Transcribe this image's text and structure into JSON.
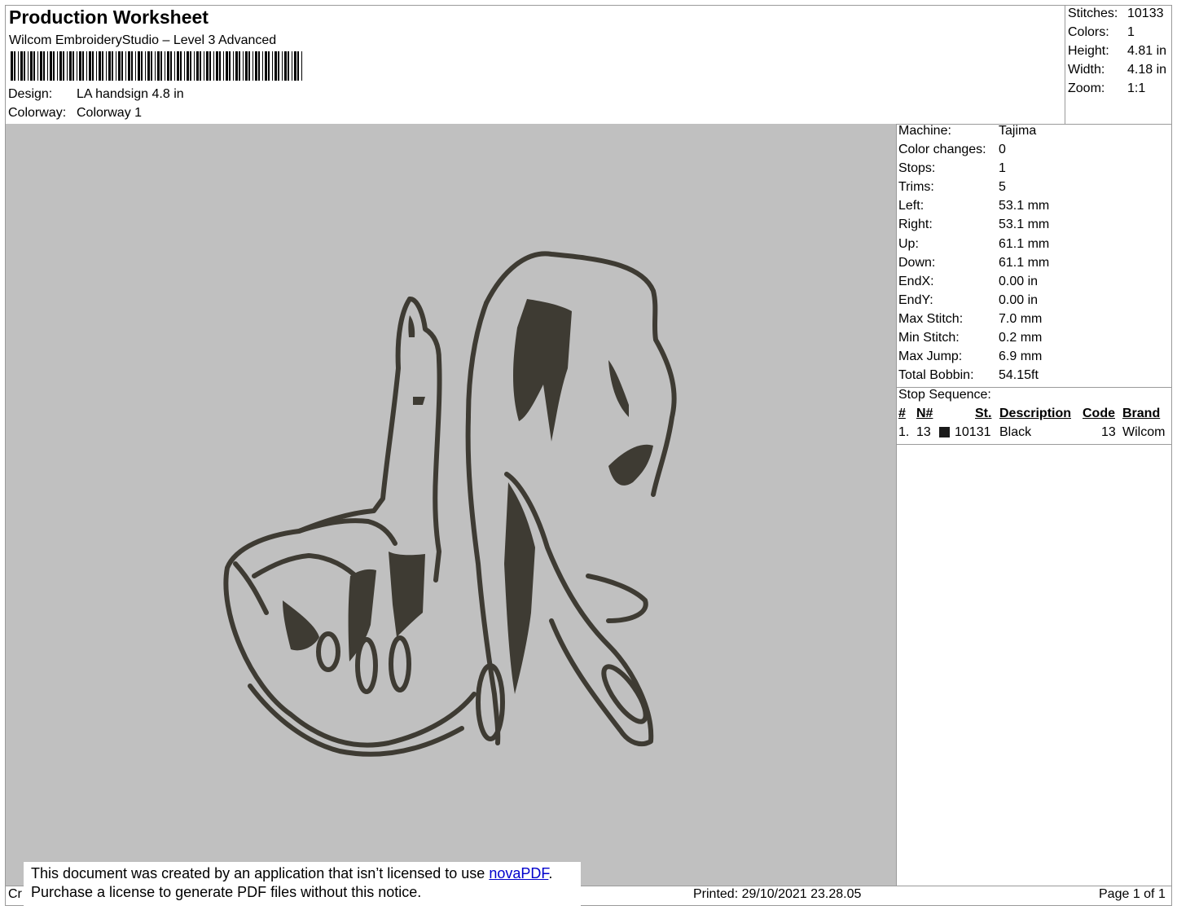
{
  "header": {
    "title": "Production Worksheet",
    "subtitle": "Wilcom EmbroideryStudio – Level 3 Advanced",
    "design_label": "Design:",
    "design_value": "LA handsign 4.8 in",
    "colorway_label": "Colorway:",
    "colorway_value": "Colorway 1"
  },
  "stats": [
    {
      "label": "Stitches:",
      "value": "10133"
    },
    {
      "label": "Colors:",
      "value": "1"
    },
    {
      "label": "Height:",
      "value": "4.81 in"
    },
    {
      "label": "Width:",
      "value": "4.18 in"
    },
    {
      "label": "Zoom:",
      "value": "1:1"
    }
  ],
  "specs": [
    {
      "label": "Machine:",
      "value": "Tajima"
    },
    {
      "label": "Color changes:",
      "value": "0"
    },
    {
      "label": "Stops:",
      "value": "1"
    },
    {
      "label": "Trims:",
      "value": "5"
    },
    {
      "label": "Left:",
      "value": "53.1 mm"
    },
    {
      "label": "Right:",
      "value": "53.1 mm"
    },
    {
      "label": "Up:",
      "value": "61.1 mm"
    },
    {
      "label": "Down:",
      "value": "61.1 mm"
    },
    {
      "label": "EndX:",
      "value": "0.00 in"
    },
    {
      "label": "EndY:",
      "value": "0.00 in"
    },
    {
      "label": "Max Stitch:",
      "value": "7.0 mm"
    },
    {
      "label": "Min Stitch:",
      "value": "0.2 mm"
    },
    {
      "label": "Max Jump:",
      "value": "6.9 mm"
    },
    {
      "label": "Total Bobbin:",
      "value": "54.15ft"
    }
  ],
  "stop_sequence": {
    "title": "Stop Sequence:",
    "columns": [
      "#",
      "N#",
      "St.",
      "Description",
      "Code",
      "Brand"
    ],
    "rows": [
      {
        "index": "1.",
        "needle": "13",
        "stitches": "10131",
        "description": "Black",
        "code": "13",
        "brand": "Wilcom",
        "color": "#1a1a1a"
      }
    ]
  },
  "canvas": {
    "background": "#c0c0c0",
    "thread_color": "#3e3b33"
  },
  "notice": {
    "line1_prefix": "This document was created by an application that isn’t licensed to use ",
    "link": "novaPDF",
    "line1_suffix": ".",
    "line2": "Purchase a license to generate PDF files without this notice."
  },
  "footer": {
    "left": "Cr",
    "printed": "Printed: 29/10/2021 23.28.05",
    "page": "Page 1 of 1"
  }
}
